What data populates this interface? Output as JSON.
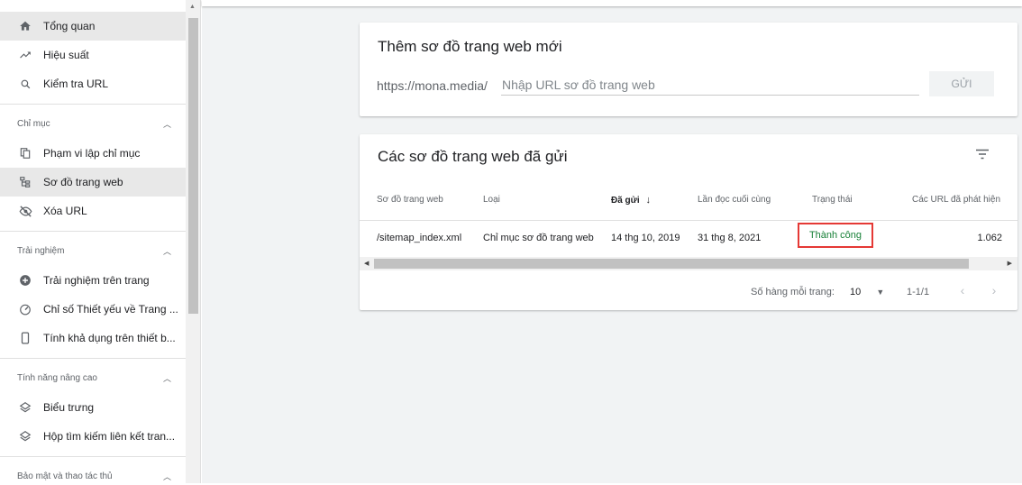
{
  "sidebar": {
    "top_items": [
      {
        "label": "Tổng quan",
        "icon": "home-icon",
        "active": true
      },
      {
        "label": "Hiệu suất",
        "icon": "trending-up-icon"
      },
      {
        "label": "Kiểm tra URL",
        "icon": "search-icon"
      }
    ],
    "sections": [
      {
        "title": "Chỉ mục",
        "items": [
          {
            "label": "Phạm vi lập chỉ mục",
            "icon": "copy-pages-icon"
          },
          {
            "label": "Sơ đồ trang web",
            "icon": "sitemap-icon",
            "active": true
          },
          {
            "label": "Xóa URL",
            "icon": "visibility-off-icon"
          }
        ]
      },
      {
        "title": "Trải nghiệm",
        "items": [
          {
            "label": "Trải nghiệm trên trang",
            "icon": "add-circle-icon"
          },
          {
            "label": "Chỉ số Thiết yếu về Trang ...",
            "icon": "speed-gauge-icon"
          },
          {
            "label": "Tính khả dụng trên thiết b...",
            "icon": "smartphone-icon"
          }
        ]
      },
      {
        "title": "Tính năng nâng cao",
        "items": [
          {
            "label": "Biểu trưng",
            "icon": "layers-icon"
          },
          {
            "label": "Hộp tìm kiếm liên kết tran...",
            "icon": "layers-icon"
          }
        ]
      },
      {
        "title": "Bảo mật và thao tác thủ",
        "items": []
      }
    ]
  },
  "add_sitemap": {
    "title": "Thêm sơ đồ trang web mới",
    "prefix": "https://mona.media/",
    "placeholder": "Nhập URL sơ đồ trang web",
    "submit_label": "GỬI"
  },
  "submitted": {
    "title": "Các sơ đồ trang web đã gửi",
    "columns": [
      "Sơ đồ trang web",
      "Loại",
      "Đã gửi",
      "Lần đọc cuối cùng",
      "Trạng thái",
      "Các URL đã phát hiện"
    ],
    "sort_indicator": "↓",
    "rows": [
      {
        "sitemap": "/sitemap_index.xml",
        "type": "Chỉ mục sơ đồ trang web",
        "submitted": "14 thg 10, 2019",
        "last_read": "31 thg 8, 2021",
        "status": "Thành công",
        "urls": "1.062"
      }
    ],
    "rows_per_page_label": "Số hàng mỗi trang:",
    "rows_per_page": "10",
    "range": "1-1/1"
  },
  "colors": {
    "success": "#188038",
    "highlight_border": "#e53935",
    "page_bg": "#f1f3f4"
  }
}
